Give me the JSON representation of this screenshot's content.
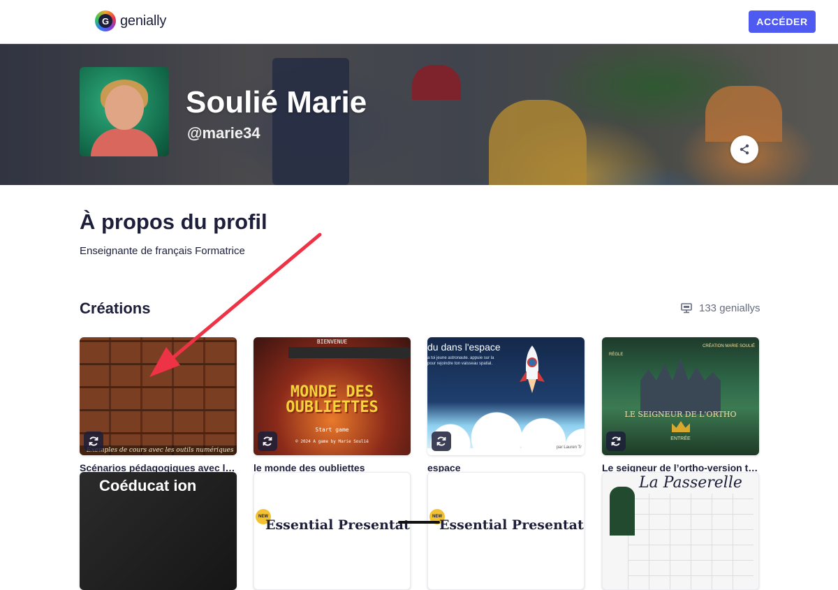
{
  "header": {
    "logo_text": "genially",
    "access_label": "ACCÉDER",
    "colors": {
      "accent": "#4f5bf0"
    }
  },
  "profile": {
    "name": "Soulié Marie",
    "handle": "@marie34"
  },
  "about": {
    "title": "À propos du profil",
    "description": "Enseignante de français Formatrice"
  },
  "creations": {
    "title": "Créations",
    "count_label": "133 geniallys",
    "count_icon": "presentation-icon",
    "items": [
      {
        "title": "Scénarios pédagogiques avec les outils numériques",
        "thumb_caption": "Exemples de cours avec les outils numériques",
        "reuse_icon": "reuse-icon"
      },
      {
        "title": "le monde des oubliettes",
        "thumb_tag": "BIENVENUE",
        "thumb_title": "MONDE DES OUBLIETTES",
        "thumb_start": "Start game",
        "thumb_credit": "© 2024 A game by Marie Soulié",
        "reuse_icon": "reuse-icon"
      },
      {
        "title": "espace",
        "thumb_title": "du dans l'espace",
        "thumb_sub": "a toi jeune astronaute. appuie sur la pour rejoindre ton vaisseau spatial.",
        "thumb_credit": "par Lauren Tr",
        "reuse_icon": "reuse-icon"
      },
      {
        "title": "Le seigneur de l’ortho-version tablette",
        "thumb_top": "CRÉATION MARIE SOULIÉ",
        "thumb_rule": "RÈGLE",
        "thumb_title": "LE SEIGNEUR DE L'ORTHO",
        "thumb_entry": "ENTRÉE",
        "reuse_icon": "reuse-icon"
      },
      {
        "title": "",
        "thumb_title": "Coéducat ion"
      },
      {
        "title": "",
        "thumb_title": "Essential Presentation",
        "thumb_badge": "NEW"
      },
      {
        "title": "",
        "thumb_title": "Essential Presentation",
        "thumb_badge": "NEW"
      },
      {
        "title": "",
        "thumb_title": "La Passerelle"
      }
    ]
  },
  "annotation": {
    "color": "#ee3346"
  }
}
